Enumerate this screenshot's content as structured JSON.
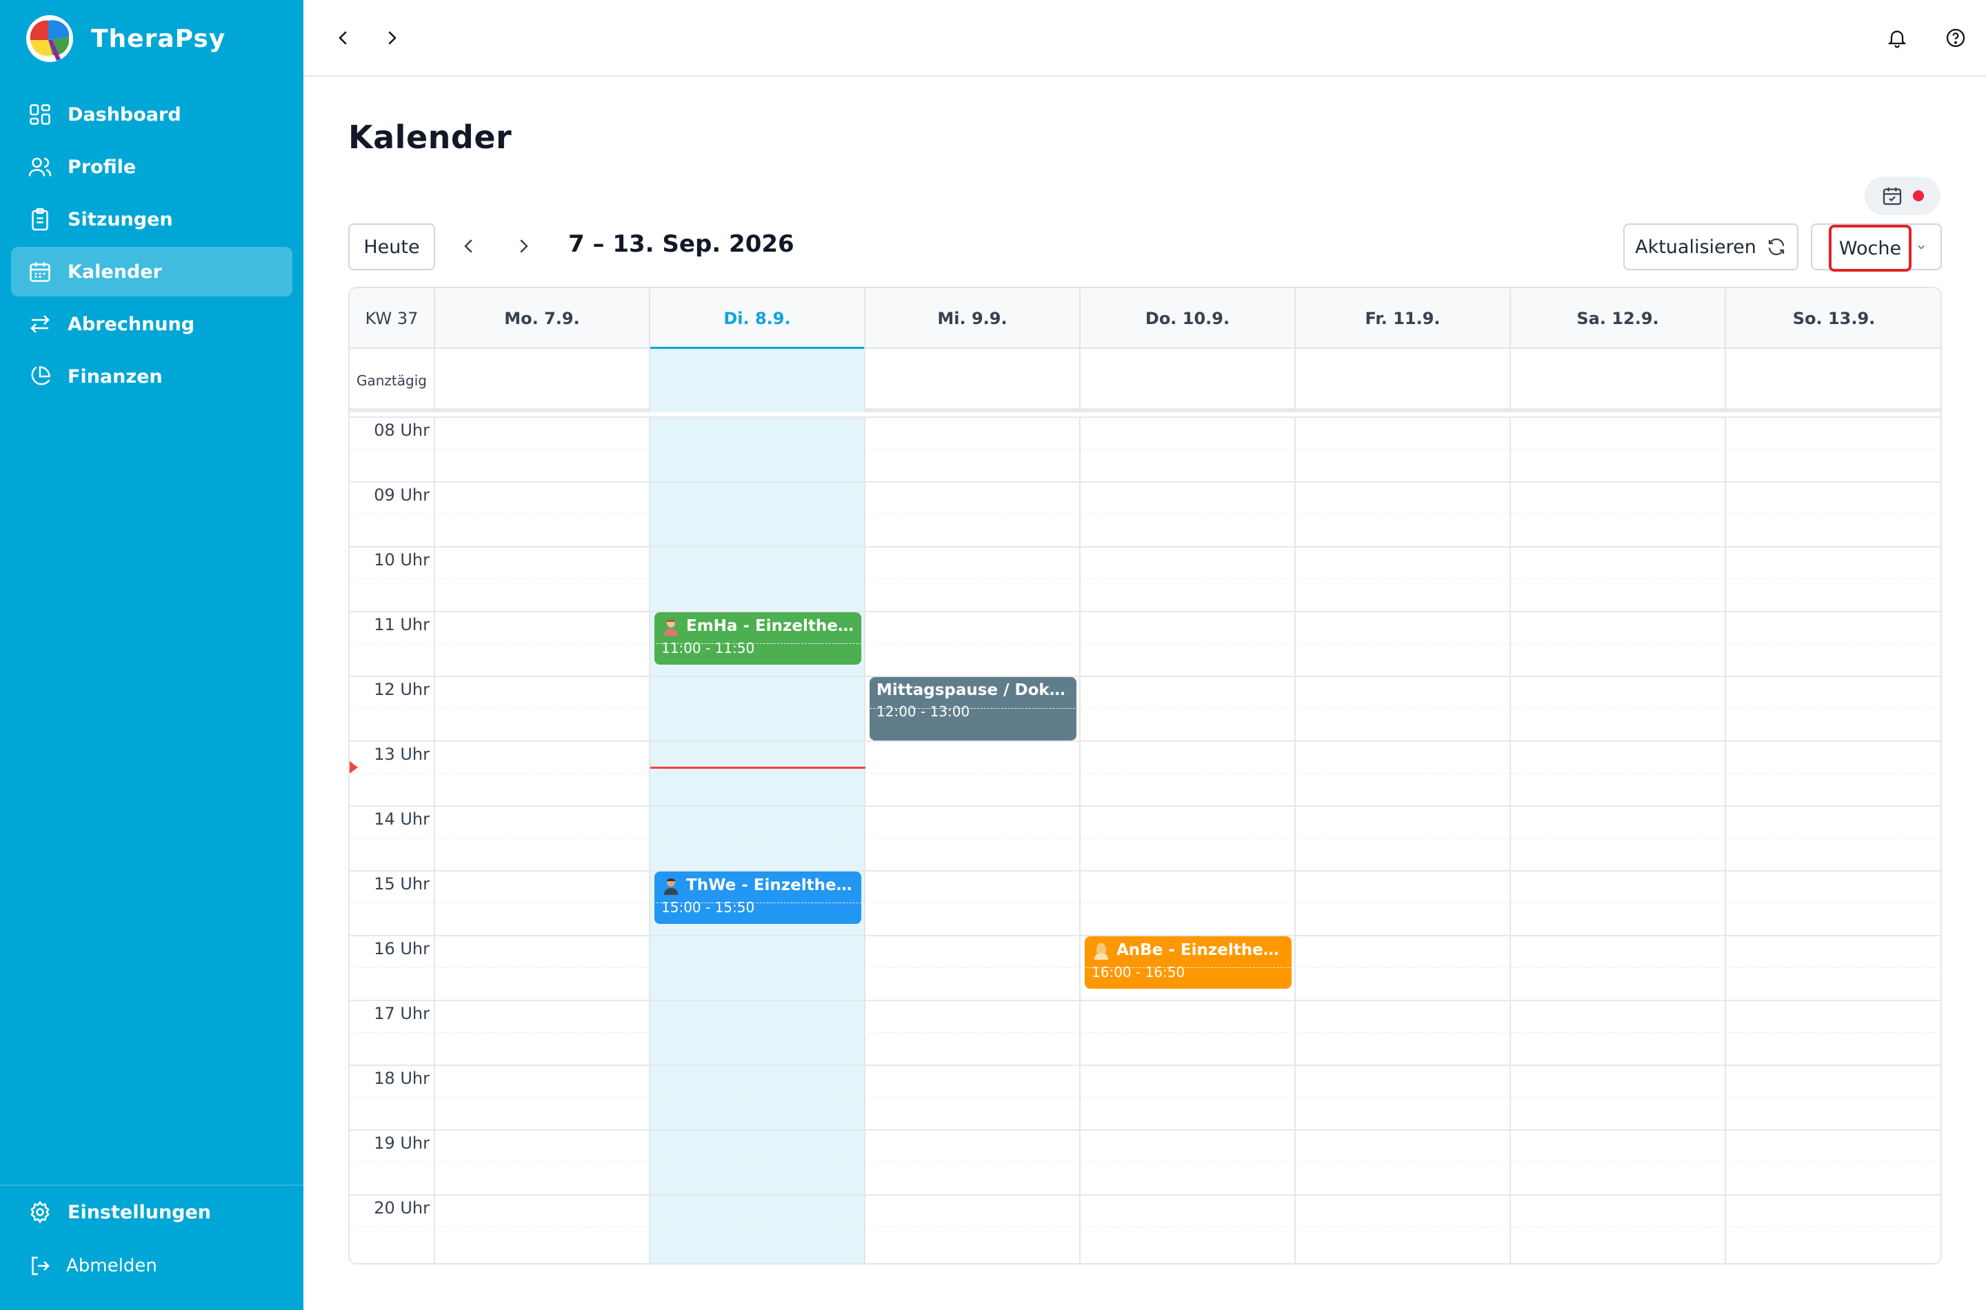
{
  "brand": {
    "name": "TheraPsy"
  },
  "sidebar": {
    "items": [
      {
        "label": "Dashboard",
        "icon": "dashboard-icon",
        "active": false
      },
      {
        "label": "Profile",
        "icon": "users-icon",
        "active": false
      },
      {
        "label": "Sitzungen",
        "icon": "clipboard-icon",
        "active": false
      },
      {
        "label": "Kalender",
        "icon": "calendar-icon",
        "active": true
      },
      {
        "label": "Abrechnung",
        "icon": "transfer-icon",
        "active": false
      },
      {
        "label": "Finanzen",
        "icon": "pie-chart-icon",
        "active": false
      }
    ],
    "settings_label": "Einstellungen",
    "logout_label": "Abmelden"
  },
  "page": {
    "title": "Kalender"
  },
  "toolbar": {
    "today_label": "Heute",
    "range_label": "7 – 13. Sep. 2026",
    "refresh_label": "Aktualisieren",
    "view_label": "Woche"
  },
  "calendar": {
    "week_label": "KW 37",
    "allday_label": "Ganztägig",
    "days": [
      {
        "label": "Mo. 7.9.",
        "today": false
      },
      {
        "label": "Di. 8.9.",
        "today": true
      },
      {
        "label": "Mi. 9.9.",
        "today": false
      },
      {
        "label": "Do. 10.9.",
        "today": false
      },
      {
        "label": "Fr. 11.9.",
        "today": false
      },
      {
        "label": "Sa. 12.9.",
        "today": false
      },
      {
        "label": "So. 13.9.",
        "today": false
      }
    ],
    "hours": [
      "08 Uhr",
      "09 Uhr",
      "10 Uhr",
      "11 Uhr",
      "12 Uhr",
      "13 Uhr",
      "14 Uhr",
      "15 Uhr",
      "16 Uhr",
      "17 Uhr",
      "18 Uhr",
      "19 Uhr",
      "20 Uhr"
    ],
    "now_time": "13:25",
    "events": [
      {
        "title": "EmHa - Einzeltherapie",
        "time": "11:00 - 11:50",
        "color": "#4caf50",
        "has_avatar": true
      },
      {
        "title": "Mittagspause / Dokumentation",
        "time": "12:00 - 13:00",
        "color": "#607d8b",
        "has_avatar": false
      },
      {
        "title": "ThWe - Einzeltherapie",
        "time": "15:00 - 15:50",
        "color": "#2196f3",
        "has_avatar": true
      },
      {
        "title": "AnBe - Einzeltherapie",
        "time": "16:00 - 16:50",
        "color": "#ff9800",
        "has_avatar": true
      }
    ]
  },
  "colors": {
    "sidebar_bg": "#00a6d6",
    "accent": "#0ea5d9",
    "today_column": "#e3f5fa",
    "now_indicator": "#ef4444",
    "notification_dot": "#ef233c"
  }
}
